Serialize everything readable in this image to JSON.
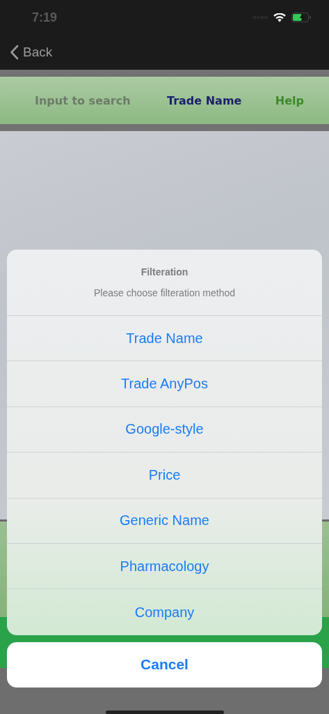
{
  "status_bar": {
    "time": "7:19"
  },
  "nav": {
    "back_label": "Back"
  },
  "header": {
    "placeholder": "Input to search",
    "filter_label": "Trade Name",
    "help_link": "Help"
  },
  "action_sheet": {
    "title": "Filteration",
    "message": "Please choose filteration method",
    "options": [
      "Trade Name",
      "Trade AnyPos",
      "Google-style",
      "Price",
      "Generic Name",
      "Pharmacology",
      "Company"
    ],
    "cancel": "Cancel"
  }
}
